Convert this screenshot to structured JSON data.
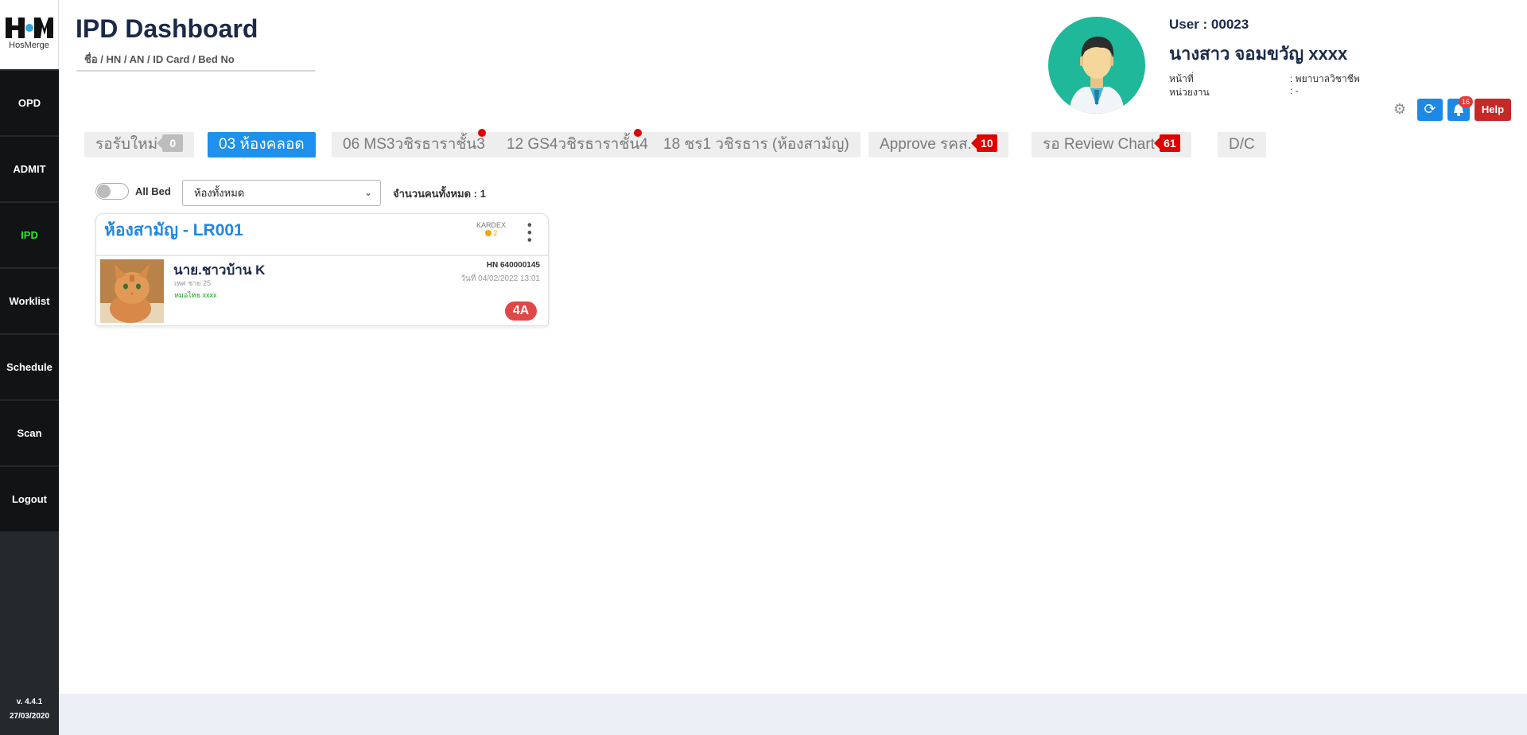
{
  "sidebar": {
    "logo_text": "HosMerge",
    "items": [
      {
        "label": "OPD"
      },
      {
        "label": "ADMIT"
      },
      {
        "label": "IPD"
      },
      {
        "label": "Worklist"
      },
      {
        "label": "Schedule"
      },
      {
        "label": "Scan"
      },
      {
        "label": "Logout"
      }
    ],
    "active_item": "IPD",
    "version": "v. 4.4.1",
    "version_date": "27/03/2020"
  },
  "header": {
    "title": "IPD Dashboard",
    "search_placeholder": "ชื่อ / HN / AN / ID Card / Bed No"
  },
  "user": {
    "id_line": "User : 00023",
    "name": "นางสาว จอมขวัญ xxxx",
    "position_label": "หน้าที่",
    "position_value": ": พยาบาลวิชาชีพ",
    "unit_label": "หน่วยงาน",
    "unit_value": ": -"
  },
  "toolbar": {
    "bell_count": "16",
    "help_label": "Help"
  },
  "tabs": [
    {
      "label": "รอรับใหม่",
      "count": "0"
    },
    {
      "label": "03 ห้องคลอด"
    },
    {
      "label": "06 MS3วชิรธาราชั้น3"
    },
    {
      "label": "12 GS4วชิรธาราชั้น4"
    },
    {
      "label": "18 ชร1 วชิรธาร (ห้องสามัญ)"
    },
    {
      "label": "Approve รคส.",
      "count": "10"
    },
    {
      "label": "รอ Review Chart",
      "count": "61"
    },
    {
      "label": "D/C"
    }
  ],
  "filters": {
    "all_bed_label": "All Bed",
    "room_select_value": "ห้องทั้งหมด",
    "total_count": "จำนวนคนทั้งหมด : 1"
  },
  "room_card": {
    "title": "ห้องสามัญ - LR001",
    "kardex_label": "KARDEX",
    "kardex_count": "2",
    "patient": {
      "name": "นาย.ชาวบ้าน K",
      "sub": "เพศ ชาย 25",
      "doctor": "หมอไทย xxxx",
      "hn": "HN 640000145",
      "date": "วันที่ 04/02/2022 13:01",
      "bed": "4A"
    }
  },
  "colors": {
    "sidebar_bg": "#25292b",
    "nav_item_bg": "#111314",
    "active_nav": "#2ee82e",
    "primary_blue": "#1e90ee",
    "danger_red": "#c62828",
    "title_navy": "#1b2a49"
  },
  "icons": [
    "settings-gear-icon",
    "refresh-icon",
    "bell-icon",
    "kebab-menu-icon",
    "toggle-switch",
    "dropdown-caret-icon"
  ]
}
